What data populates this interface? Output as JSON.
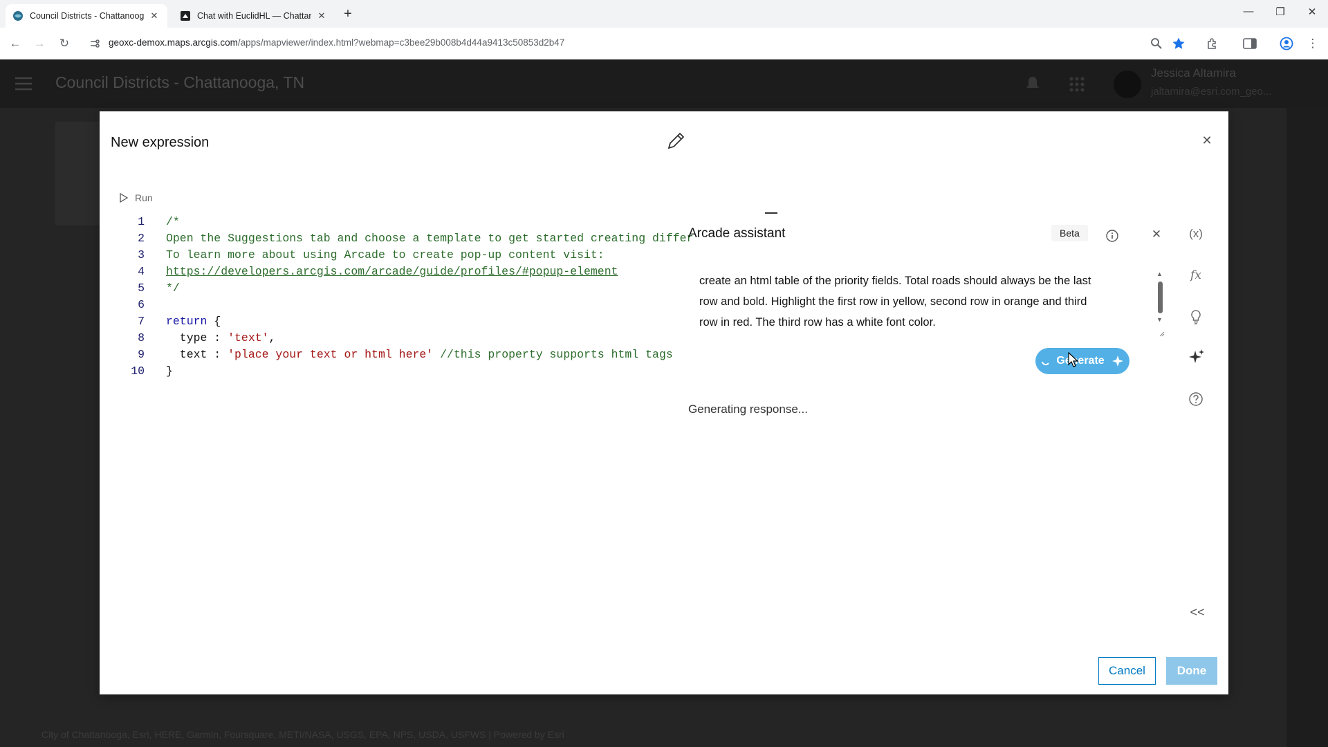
{
  "browser": {
    "tabs": [
      {
        "title": "Council Districts - Chattanooga",
        "active": true
      },
      {
        "title": "Chat with EuclidHL — Chattanoo",
        "active": false
      }
    ],
    "new_tab_label": "+",
    "window_controls": {
      "minimize": "—",
      "maximize": "❐",
      "close": "✕"
    },
    "url_domain": "geoxc-demox.maps.arcgis.com",
    "url_path": "/apps/mapviewer/index.html?webmap=c3bee29b008b4d44a9413c50853d2b47"
  },
  "background_app": {
    "title": "Council Districts - Chattanooga, TN",
    "user_name": "Jessica Altamira",
    "user_email": "jaltamira@esri.com_geo...",
    "attribution": "City of Chattanooga, Esri, HERE, Garmin, Foursquare, METI/NASA, USGS, EPA, NPS, USDA, USFWS | Powered by Esri"
  },
  "modal": {
    "title": "New expression",
    "run_label": "Run",
    "editor_lines": [
      {
        "num": "1",
        "parts": [
          {
            "cls": "c-com",
            "text": "/*"
          }
        ]
      },
      {
        "num": "2",
        "parts": [
          {
            "cls": "c-com",
            "text": "Open the Suggestions tab and choose a template to get started creating differ"
          }
        ]
      },
      {
        "num": "3",
        "parts": [
          {
            "cls": "c-com",
            "text": "To learn more about using Arcade to create pop-up content visit:"
          }
        ]
      },
      {
        "num": "4",
        "parts": [
          {
            "cls": "c-link",
            "text": "https://developers.arcgis.com/arcade/guide/profiles/#popup-element"
          }
        ]
      },
      {
        "num": "5",
        "parts": [
          {
            "cls": "c-com",
            "text": "*/"
          }
        ]
      },
      {
        "num": "6",
        "parts": [
          {
            "cls": "c-plain",
            "text": ""
          }
        ]
      },
      {
        "num": "7",
        "parts": [
          {
            "cls": "c-key",
            "text": "return"
          },
          {
            "cls": "c-plain",
            "text": " {"
          }
        ]
      },
      {
        "num": "8",
        "parts": [
          {
            "cls": "c-plain",
            "text": "  type : "
          },
          {
            "cls": "c-str",
            "text": "'text'"
          },
          {
            "cls": "c-plain",
            "text": ","
          }
        ]
      },
      {
        "num": "9",
        "parts": [
          {
            "cls": "c-plain",
            "text": "  text : "
          },
          {
            "cls": "c-str",
            "text": "'place your text or html here'"
          },
          {
            "cls": "c-plain",
            "text": " "
          },
          {
            "cls": "c-com",
            "text": "//this property supports html tags"
          }
        ]
      },
      {
        "num": "10",
        "parts": [
          {
            "cls": "c-plain",
            "text": "}"
          }
        ]
      }
    ],
    "assistant": {
      "title": "Arcade assistant",
      "beta_label": "Beta",
      "prompt_text": "create an html table of the priority fields. Total roads should always be the last row and bold. Highlight the first row in yellow, second row in orange and third row in red. The third row has a white font color.",
      "generate_label": "Generate",
      "status_text": "Generating response..."
    },
    "side_tools": [
      {
        "name": "variables-icon",
        "glyph": "(x)"
      },
      {
        "name": "functions-icon",
        "glyph": "fx"
      },
      {
        "name": "suggestions-icon",
        "glyph": "bulb"
      },
      {
        "name": "assistant-icon",
        "glyph": "sparkle"
      },
      {
        "name": "help-icon",
        "glyph": "?"
      }
    ],
    "collapse_label": "<<",
    "cancel_label": "Cancel",
    "done_label": "Done"
  },
  "colors": {
    "accent": "#007ac2",
    "generate_bg": "#52b0e6",
    "done_bg": "#8fc7ea",
    "comment": "#2d6d2d",
    "keyword": "#1a1aa6",
    "string": "#a31515"
  }
}
